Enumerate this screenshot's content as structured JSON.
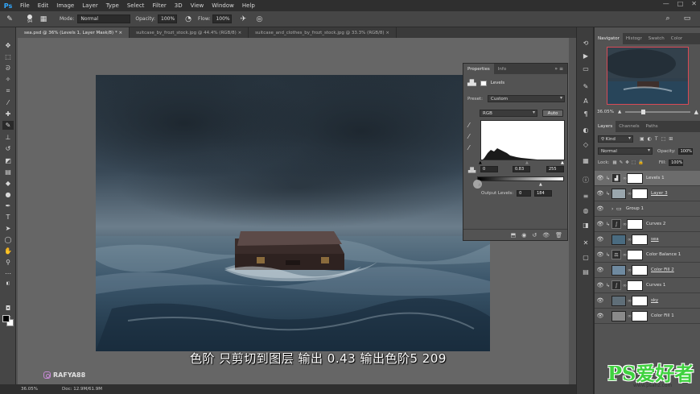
{
  "app": {
    "logo": "Ps",
    "menu": [
      "File",
      "Edit",
      "Image",
      "Layer",
      "Type",
      "Select",
      "Filter",
      "3D",
      "View",
      "Window",
      "Help"
    ],
    "window_controls": [
      "—",
      "□",
      "✕"
    ]
  },
  "options_bar": {
    "brush_size": "94",
    "mode_label": "Mode:",
    "mode_value": "Normal",
    "opacity_label": "Opacity:",
    "opacity_value": "100%",
    "flow_label": "Flow:",
    "flow_value": "100%"
  },
  "tabs": [
    {
      "label": "sea.psd @ 36% (Levels 1, Layer Mask/8) *",
      "close": "×"
    },
    {
      "label": "suitcase_by_frozt_stock.jpg @ 44.4% (RGB/8)",
      "close": "×"
    },
    {
      "label": "suitcase_and_clothes_by_frozt_stock.jpg @ 33.3% (RGB/8)",
      "close": "×"
    }
  ],
  "status_bar": {
    "zoom": "36.05%",
    "doc": "Doc: 12.9M/61.9M"
  },
  "subtitle": "色阶  只剪切到图层   输出 0.43  输出色阶5  209",
  "channel_credit": "RAFYA88",
  "properties_panel": {
    "tabs": [
      "Properties",
      "Info"
    ],
    "title": "Levels",
    "preset_label": "Preset:",
    "preset_value": "Custom",
    "channel_value": "RGB",
    "auto_label": "Auto",
    "input_black": "0",
    "input_mid": "0.83",
    "input_white": "255",
    "output_label": "Output Levels:",
    "output_black": "0",
    "output_white": "184"
  },
  "navigator": {
    "tabs": [
      "Navigator",
      "Histogr",
      "Swatch",
      "Color"
    ],
    "zoom": "36.05%",
    "zoom_level_fraction": 0.25
  },
  "layers_panel": {
    "tabs": [
      "Layers",
      "Channels",
      "Paths"
    ],
    "filter_kind": "Kind",
    "blend_mode": "Normal",
    "opacity_label": "Opacity:",
    "opacity_value": "100%",
    "lock_label": "Lock:",
    "fill_label": "Fill:",
    "fill_value": "100%",
    "layers": [
      {
        "name": "Levels 1",
        "kind": "levels",
        "clipped": true,
        "selected": true
      },
      {
        "name": "Layer 3",
        "kind": "pixel",
        "clipped": true,
        "underlined": true
      },
      {
        "name": "Group 1",
        "kind": "group"
      },
      {
        "name": "Curves 2",
        "kind": "curves",
        "clipped": true
      },
      {
        "name": "sea",
        "kind": "pixel-sea",
        "underlined": true
      },
      {
        "name": "Color Balance 1",
        "kind": "balance",
        "clipped": true
      },
      {
        "name": "Color Fill 2",
        "kind": "fill-blue",
        "underlined": true
      },
      {
        "name": "Curves 1",
        "kind": "curves",
        "clipped": true
      },
      {
        "name": "sky",
        "kind": "pixel-sky",
        "underlined": true
      },
      {
        "name": "Color Fill 1",
        "kind": "fill-gray"
      }
    ]
  },
  "watermark": {
    "text": "PS爱好者",
    "url": "www.psahz.com"
  },
  "colors": {
    "ui_dark": "#2f2f2f",
    "ui_panel": "#535353",
    "accent_nav": "#d94a56",
    "logo_blue": "#31a8ff",
    "watermark_green": "#3fd23f"
  }
}
